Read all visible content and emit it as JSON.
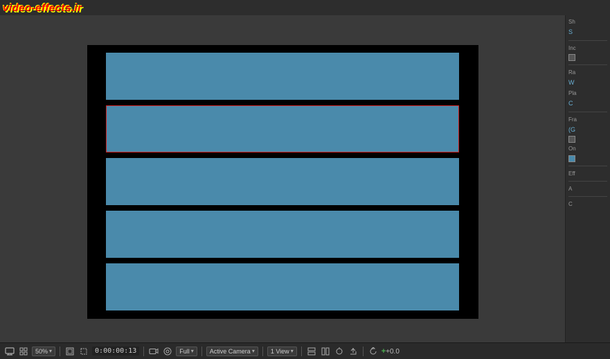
{
  "watermark": {
    "text": "video-effects.ir"
  },
  "viewer": {
    "bars": [
      {
        "id": 1,
        "highlighted": false
      },
      {
        "id": 2,
        "highlighted": true
      },
      {
        "id": 3,
        "highlighted": false
      },
      {
        "id": 4,
        "highlighted": false
      },
      {
        "id": 5,
        "highlighted": false
      }
    ]
  },
  "right_panel": {
    "section1_label": "Sh",
    "section1_value": "S",
    "section2_label": "Inc",
    "section3_label": "Ra",
    "section3_value": "W",
    "section4_label": "Pla",
    "section4_value": "C",
    "section5_label": "Fra",
    "section5_value": "(G",
    "section6_label": "On",
    "section7_label": "Eff",
    "section8_label": "A",
    "section9_label": "C"
  },
  "toolbar": {
    "zoom_label": "50%",
    "time_label": "0:00:00:13",
    "quality_label": "Full",
    "camera_label": "Active Camera",
    "view_label": "1 View",
    "plus_value": "+0.0",
    "icons": {
      "monitor": "🖥",
      "grid": "⊞",
      "frame": "◫",
      "camera_icon": "📷",
      "color_wheel": "◉",
      "chain": "⛓",
      "layers": "▦",
      "add": "✚"
    }
  }
}
